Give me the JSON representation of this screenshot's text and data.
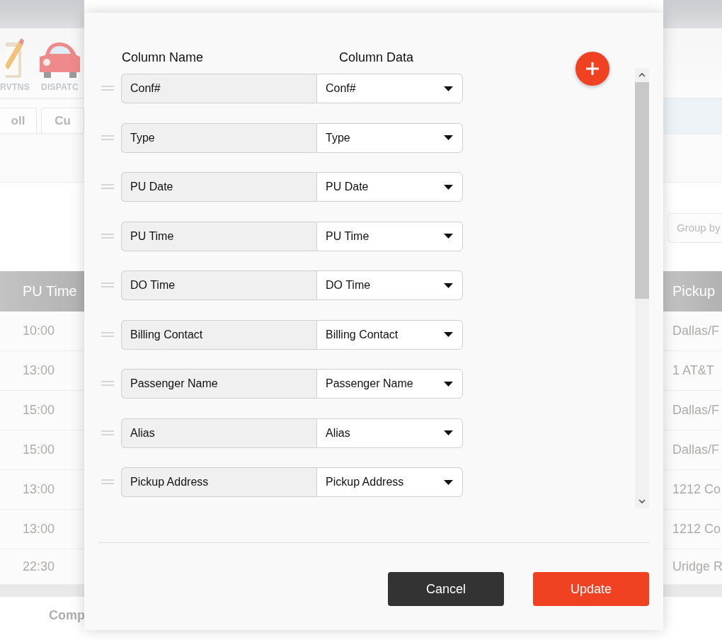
{
  "background": {
    "toolbar": [
      {
        "label": "RVTNS"
      },
      {
        "label": "DISPATC"
      }
    ],
    "tabs": [
      {
        "label": "oll"
      },
      {
        "label": "Cu"
      }
    ],
    "group_by": {
      "placeholder": "Group by"
    },
    "table": {
      "columns": [
        "PU Time",
        "Pickup"
      ],
      "rows": [
        [
          "10:00",
          "Dallas/F"
        ],
        [
          "13:00",
          "1 AT&T"
        ],
        [
          "15:00",
          "Dallas/F"
        ],
        [
          "15:00",
          "Dallas/F"
        ],
        [
          "13:00",
          "1212 Co"
        ],
        [
          "13:00",
          "1212 Co"
        ],
        [
          "22:30",
          "Uridge R"
        ]
      ]
    },
    "footer": "Comp"
  },
  "dialog": {
    "headers": [
      "Column Name",
      "Column Data"
    ],
    "rows": [
      {
        "name": "Conf#",
        "data": "Conf#"
      },
      {
        "name": "Type",
        "data": "Type"
      },
      {
        "name": "PU Date",
        "data": "PU Date"
      },
      {
        "name": "PU Time",
        "data": "PU Time"
      },
      {
        "name": "DO Time",
        "data": "DO Time"
      },
      {
        "name": "Billing Contact",
        "data": "Billing Contact"
      },
      {
        "name": "Passenger Name",
        "data": "Passenger Name"
      },
      {
        "name": "Alias",
        "data": "Alias"
      },
      {
        "name": "Pickup Address",
        "data": "Pickup Address"
      }
    ],
    "buttons": [
      {
        "label": "Cancel",
        "kind": "secondary"
      },
      {
        "label": "Update",
        "kind": "primary"
      }
    ]
  }
}
